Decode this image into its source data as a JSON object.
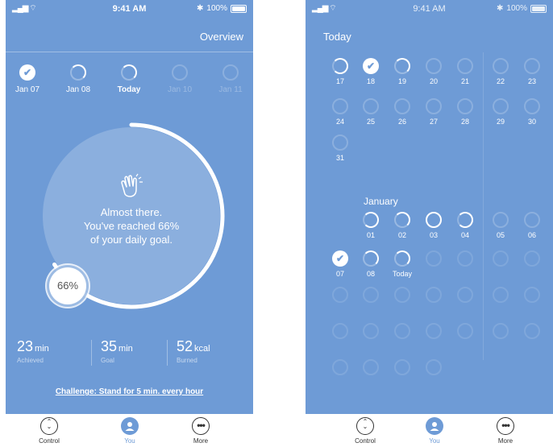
{
  "status": {
    "time": "9:41 AM",
    "battery": "100%"
  },
  "left": {
    "overview_label": "Overview",
    "days": [
      {
        "label": "Jan 07",
        "state": "done"
      },
      {
        "label": "Jan 08",
        "state": "part"
      },
      {
        "label": "Today",
        "state": "part"
      },
      {
        "label": "Jan 10",
        "state": "empty"
      },
      {
        "label": "Jan 11",
        "state": "empty"
      }
    ],
    "progress": 0.66,
    "progress_label": "66%",
    "message": [
      "Almost there.",
      "You've reached 66%",
      "of your daily goal."
    ],
    "stats": [
      {
        "value": "23",
        "unit": "min",
        "sub": "Achieved"
      },
      {
        "value": "35",
        "unit": "min",
        "sub": "Goal"
      },
      {
        "value": "52",
        "unit": "kcal",
        "sub": "Burned"
      }
    ],
    "challenge": "Challenge: Stand for 5 min. every hour"
  },
  "tabs": [
    {
      "label": "Control",
      "icon": "control-icon"
    },
    {
      "label": "You",
      "icon": "user-icon"
    },
    {
      "label": "More",
      "icon": "more-icon"
    }
  ],
  "right": {
    "today_title": "Today",
    "december": [
      {
        "n": "17",
        "s": "partL"
      },
      {
        "n": "18",
        "s": "done"
      },
      {
        "n": "19",
        "s": "part"
      },
      {
        "n": "20",
        "s": "empty"
      },
      {
        "n": "21",
        "s": "empty"
      },
      {
        "n": "22",
        "s": "empty"
      },
      {
        "n": "23",
        "s": "empty"
      },
      {
        "n": "24",
        "s": "empty"
      },
      {
        "n": "25",
        "s": "empty"
      },
      {
        "n": "26",
        "s": "empty"
      },
      {
        "n": "27",
        "s": "empty"
      },
      {
        "n": "28",
        "s": "empty"
      },
      {
        "n": "29",
        "s": "empty"
      },
      {
        "n": "30",
        "s": "empty"
      },
      {
        "n": "31",
        "s": "empty"
      }
    ],
    "january_title": "January",
    "january": [
      {
        "n": "01",
        "s": "partL"
      },
      {
        "n": "02",
        "s": "part"
      },
      {
        "n": "03",
        "s": "full"
      },
      {
        "n": "04",
        "s": "partL"
      },
      {
        "n": "05",
        "s": "empty"
      },
      {
        "n": "06",
        "s": "empty"
      },
      {
        "n": "07",
        "s": "done"
      },
      {
        "n": "08",
        "s": "part"
      },
      {
        "n": "Today",
        "s": "part"
      }
    ]
  }
}
